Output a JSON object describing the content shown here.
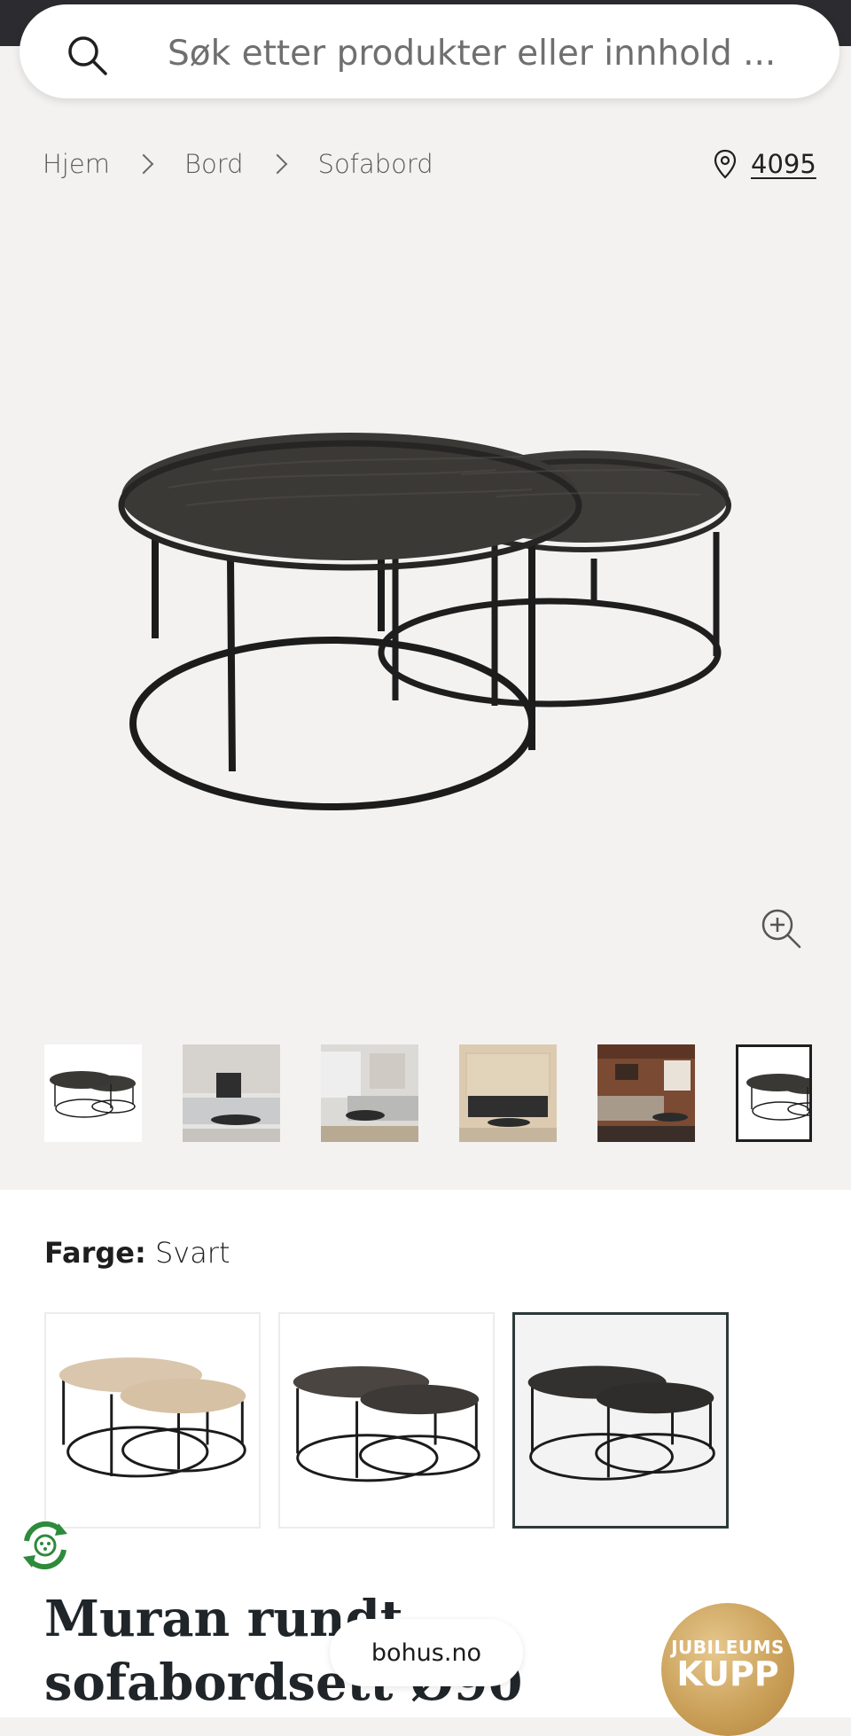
{
  "search": {
    "placeholder": "Søk etter produkter eller innhold ..."
  },
  "breadcrumb": {
    "items": [
      "Hjem",
      "Bord",
      "Sofabord"
    ]
  },
  "location": {
    "postcode": "4095"
  },
  "product": {
    "color_label": "Farge:",
    "color_value": "Svart",
    "title_line1": "Muran rundt",
    "title_line2": "sofabordsett Ø90",
    "variants": [
      "natural-oak",
      "dark-brown",
      "black"
    ],
    "selected_variant": 3
  },
  "gallery": {
    "thumb_count": 6,
    "active_index": 6
  },
  "footer": {
    "domain": "bohus.no"
  },
  "badge": {
    "line1": "JUBILEUMS",
    "line2": "KUPP"
  },
  "colors": {
    "topbar": "#2c2c30",
    "badge": "#c89d55",
    "table_top": "#3d3b38",
    "background": "#f4f2f1"
  }
}
